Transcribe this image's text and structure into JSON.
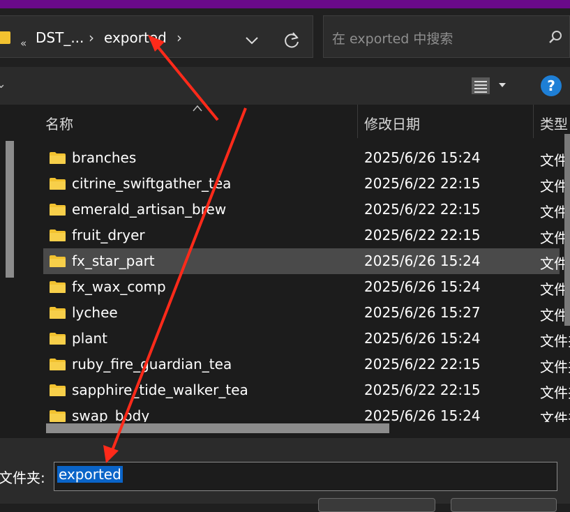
{
  "address_bar": {
    "breadcrumbs": [
      "DST_...",
      "exported"
    ],
    "overflow_glyph": "«",
    "separator": "›"
  },
  "search": {
    "placeholder": "在 exported 中搜索"
  },
  "columns": {
    "name": "名称",
    "date_modified": "修改日期",
    "type": "类型"
  },
  "files": [
    {
      "name": "branches",
      "date": "2025/6/26 15:24",
      "type": "文件夹"
    },
    {
      "name": "citrine_swiftgather_tea",
      "date": "2025/6/22 22:15",
      "type": "文件夹"
    },
    {
      "name": "emerald_artisan_brew",
      "date": "2025/6/22 22:15",
      "type": "文件夹"
    },
    {
      "name": "fruit_dryer",
      "date": "2025/6/22 22:15",
      "type": "文件夹"
    },
    {
      "name": "fx_star_part",
      "date": "2025/6/26 15:24",
      "type": "文件夹",
      "selected": true
    },
    {
      "name": "fx_wax_comp",
      "date": "2025/6/26 15:24",
      "type": "文件夹"
    },
    {
      "name": "lychee",
      "date": "2025/6/26 15:27",
      "type": "文件夹"
    },
    {
      "name": "plant",
      "date": "2025/6/26 15:24",
      "type": "文件夹"
    },
    {
      "name": "ruby_fire_guardian_tea",
      "date": "2025/6/22 22:15",
      "type": "文件夹"
    },
    {
      "name": "sapphire_tide_walker_tea",
      "date": "2025/6/22 22:15",
      "type": "文件夹"
    },
    {
      "name": "swap_body",
      "date": "2025/6/26 15:24",
      "type": "文件夹"
    }
  ],
  "folder_field": {
    "label": "文件夹:",
    "value": "exported"
  },
  "icons": {
    "view": "details-view-icon",
    "help": "help-icon",
    "search": "search-icon",
    "refresh": "refresh-icon",
    "folder": "folder-icon"
  },
  "help_glyph": "?",
  "colors": {
    "window_bg": "#1f1f1f",
    "title_accent": "#6a0a8a",
    "selection_row": "#4a4a4a",
    "text_selection": "#0a64c8",
    "folder": "#f2c230",
    "annotation_arrow": "#ff2a1a"
  }
}
